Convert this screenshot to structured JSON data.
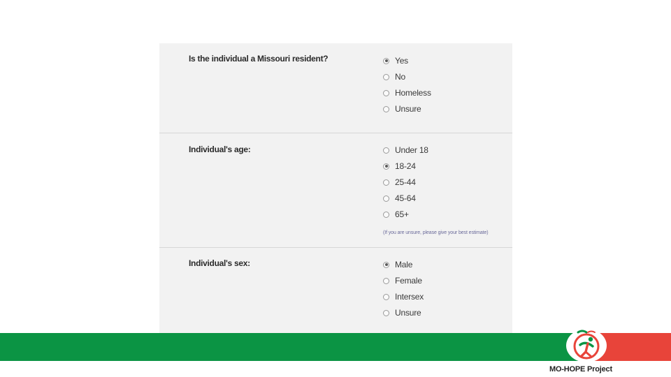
{
  "form": {
    "residency": {
      "question": "Is the individual a Missouri resident?",
      "options": [
        {
          "label": "Yes",
          "checked": true
        },
        {
          "label": "No",
          "checked": false
        },
        {
          "label": "Homeless",
          "checked": false
        },
        {
          "label": "Unsure",
          "checked": false
        }
      ]
    },
    "age": {
      "question": "Individual's age:",
      "options": [
        {
          "label": "Under 18",
          "checked": false
        },
        {
          "label": "18-24",
          "checked": true
        },
        {
          "label": "25-44",
          "checked": false
        },
        {
          "label": "45-64",
          "checked": false
        },
        {
          "label": "65+",
          "checked": false
        }
      ],
      "hint": "(If you are unsure, please give your best estimate)"
    },
    "sex": {
      "question": "Individual's sex:",
      "options": [
        {
          "label": "Male",
          "checked": true
        },
        {
          "label": "Female",
          "checked": false
        },
        {
          "label": "Intersex",
          "checked": false
        },
        {
          "label": "Unsure",
          "checked": false
        }
      ]
    }
  },
  "footer": {
    "brand": "MO-HOPE Project",
    "colors": {
      "green": "#0b9444",
      "red": "#e8443a"
    },
    "logo_icon": "mo-hope-figure-icon"
  }
}
